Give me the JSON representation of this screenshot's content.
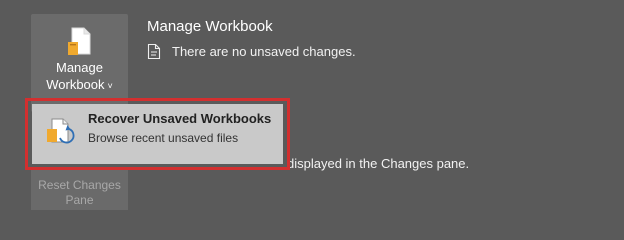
{
  "manage_button": {
    "line1": "Manage",
    "line2": "Workbook",
    "chevron": "˅",
    "icon": "workbook-document-icon"
  },
  "reset_button": {
    "line1": "Reset Changes",
    "line2": "Pane"
  },
  "section": {
    "title": "Manage Workbook",
    "status": "There are no unsaved changes.",
    "status_icon": "document-icon"
  },
  "changes_pane_text": "displayed in the Changes pane.",
  "dropdown": {
    "title": "Recover Unsaved Workbooks",
    "subtitle": "Browse recent unsaved files",
    "icon": "recover-workbook-icon",
    "highlight_color": "#d32f2f"
  }
}
